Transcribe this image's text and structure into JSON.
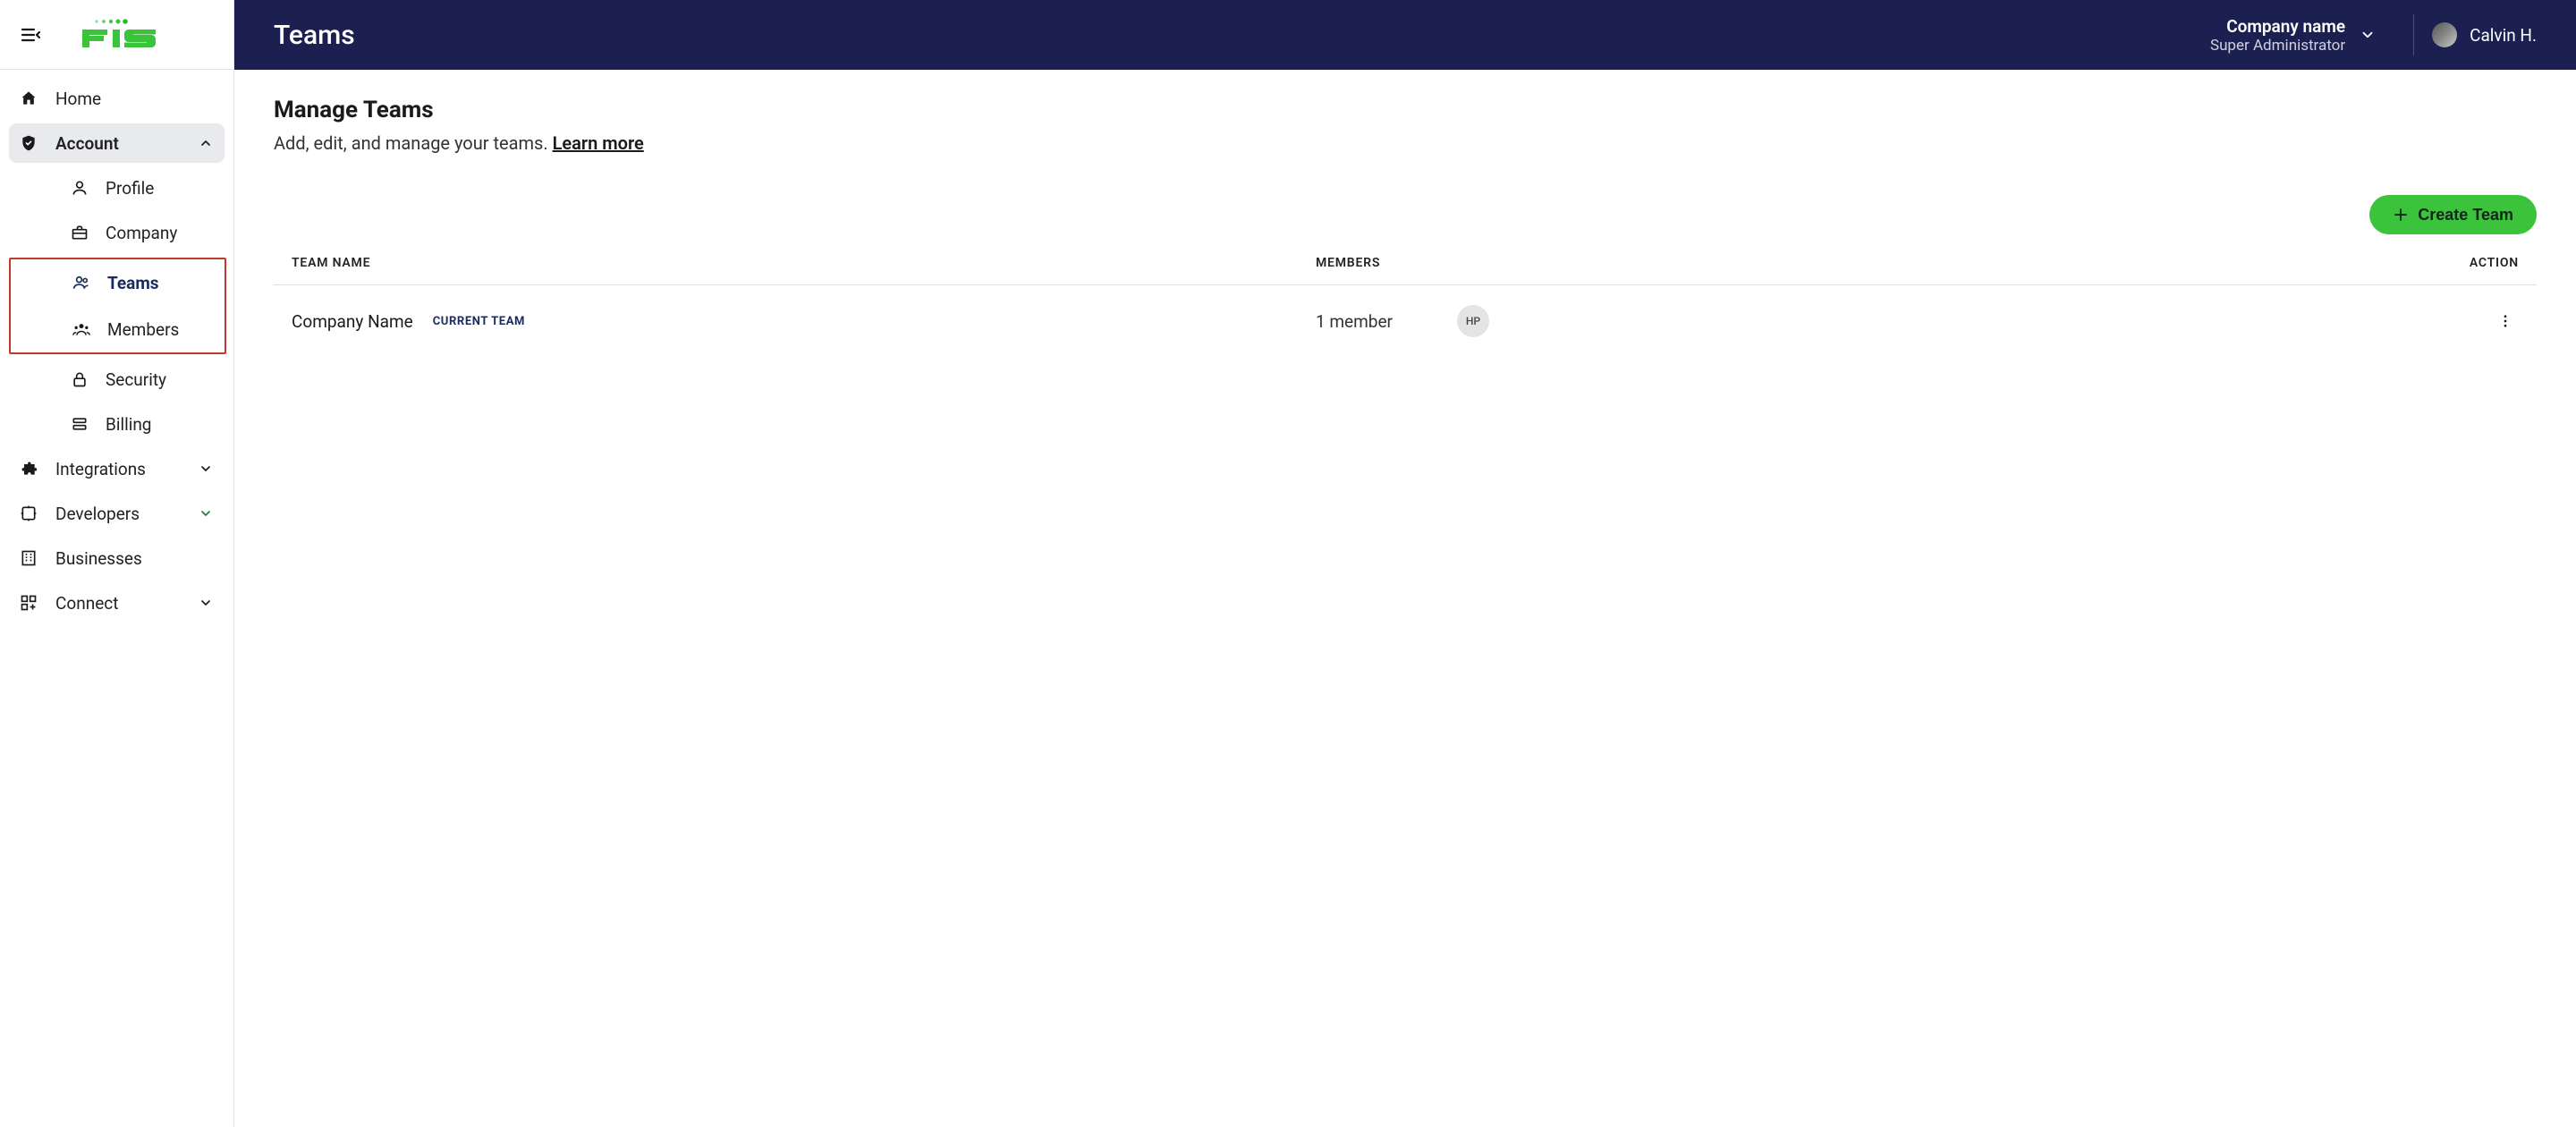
{
  "header": {
    "page_title": "Teams",
    "company_name": "Company name",
    "company_role": "Super Administrator",
    "user_name": "Calvin H."
  },
  "sidebar": {
    "items": [
      {
        "label": "Home"
      },
      {
        "label": "Account"
      },
      {
        "label": "Integrations"
      },
      {
        "label": "Developers"
      },
      {
        "label": "Businesses"
      },
      {
        "label": "Connect"
      }
    ],
    "account_sub": [
      {
        "label": "Profile"
      },
      {
        "label": "Company"
      },
      {
        "label": "Teams"
      },
      {
        "label": "Members"
      },
      {
        "label": "Security"
      },
      {
        "label": "Billing"
      }
    ]
  },
  "content": {
    "title": "Manage Teams",
    "subtitle_prefix": "Add, edit, and manage your teams. ",
    "subtitle_link": "Learn more",
    "create_button": "Create Team",
    "columns": {
      "team_name": "TEAM NAME",
      "members": "MEMBERS",
      "action": "ACTION"
    },
    "rows": [
      {
        "name": "Company Name",
        "tag": "CURRENT TEAM",
        "member_count": "1 member",
        "avatar_initials": "HP"
      }
    ]
  }
}
